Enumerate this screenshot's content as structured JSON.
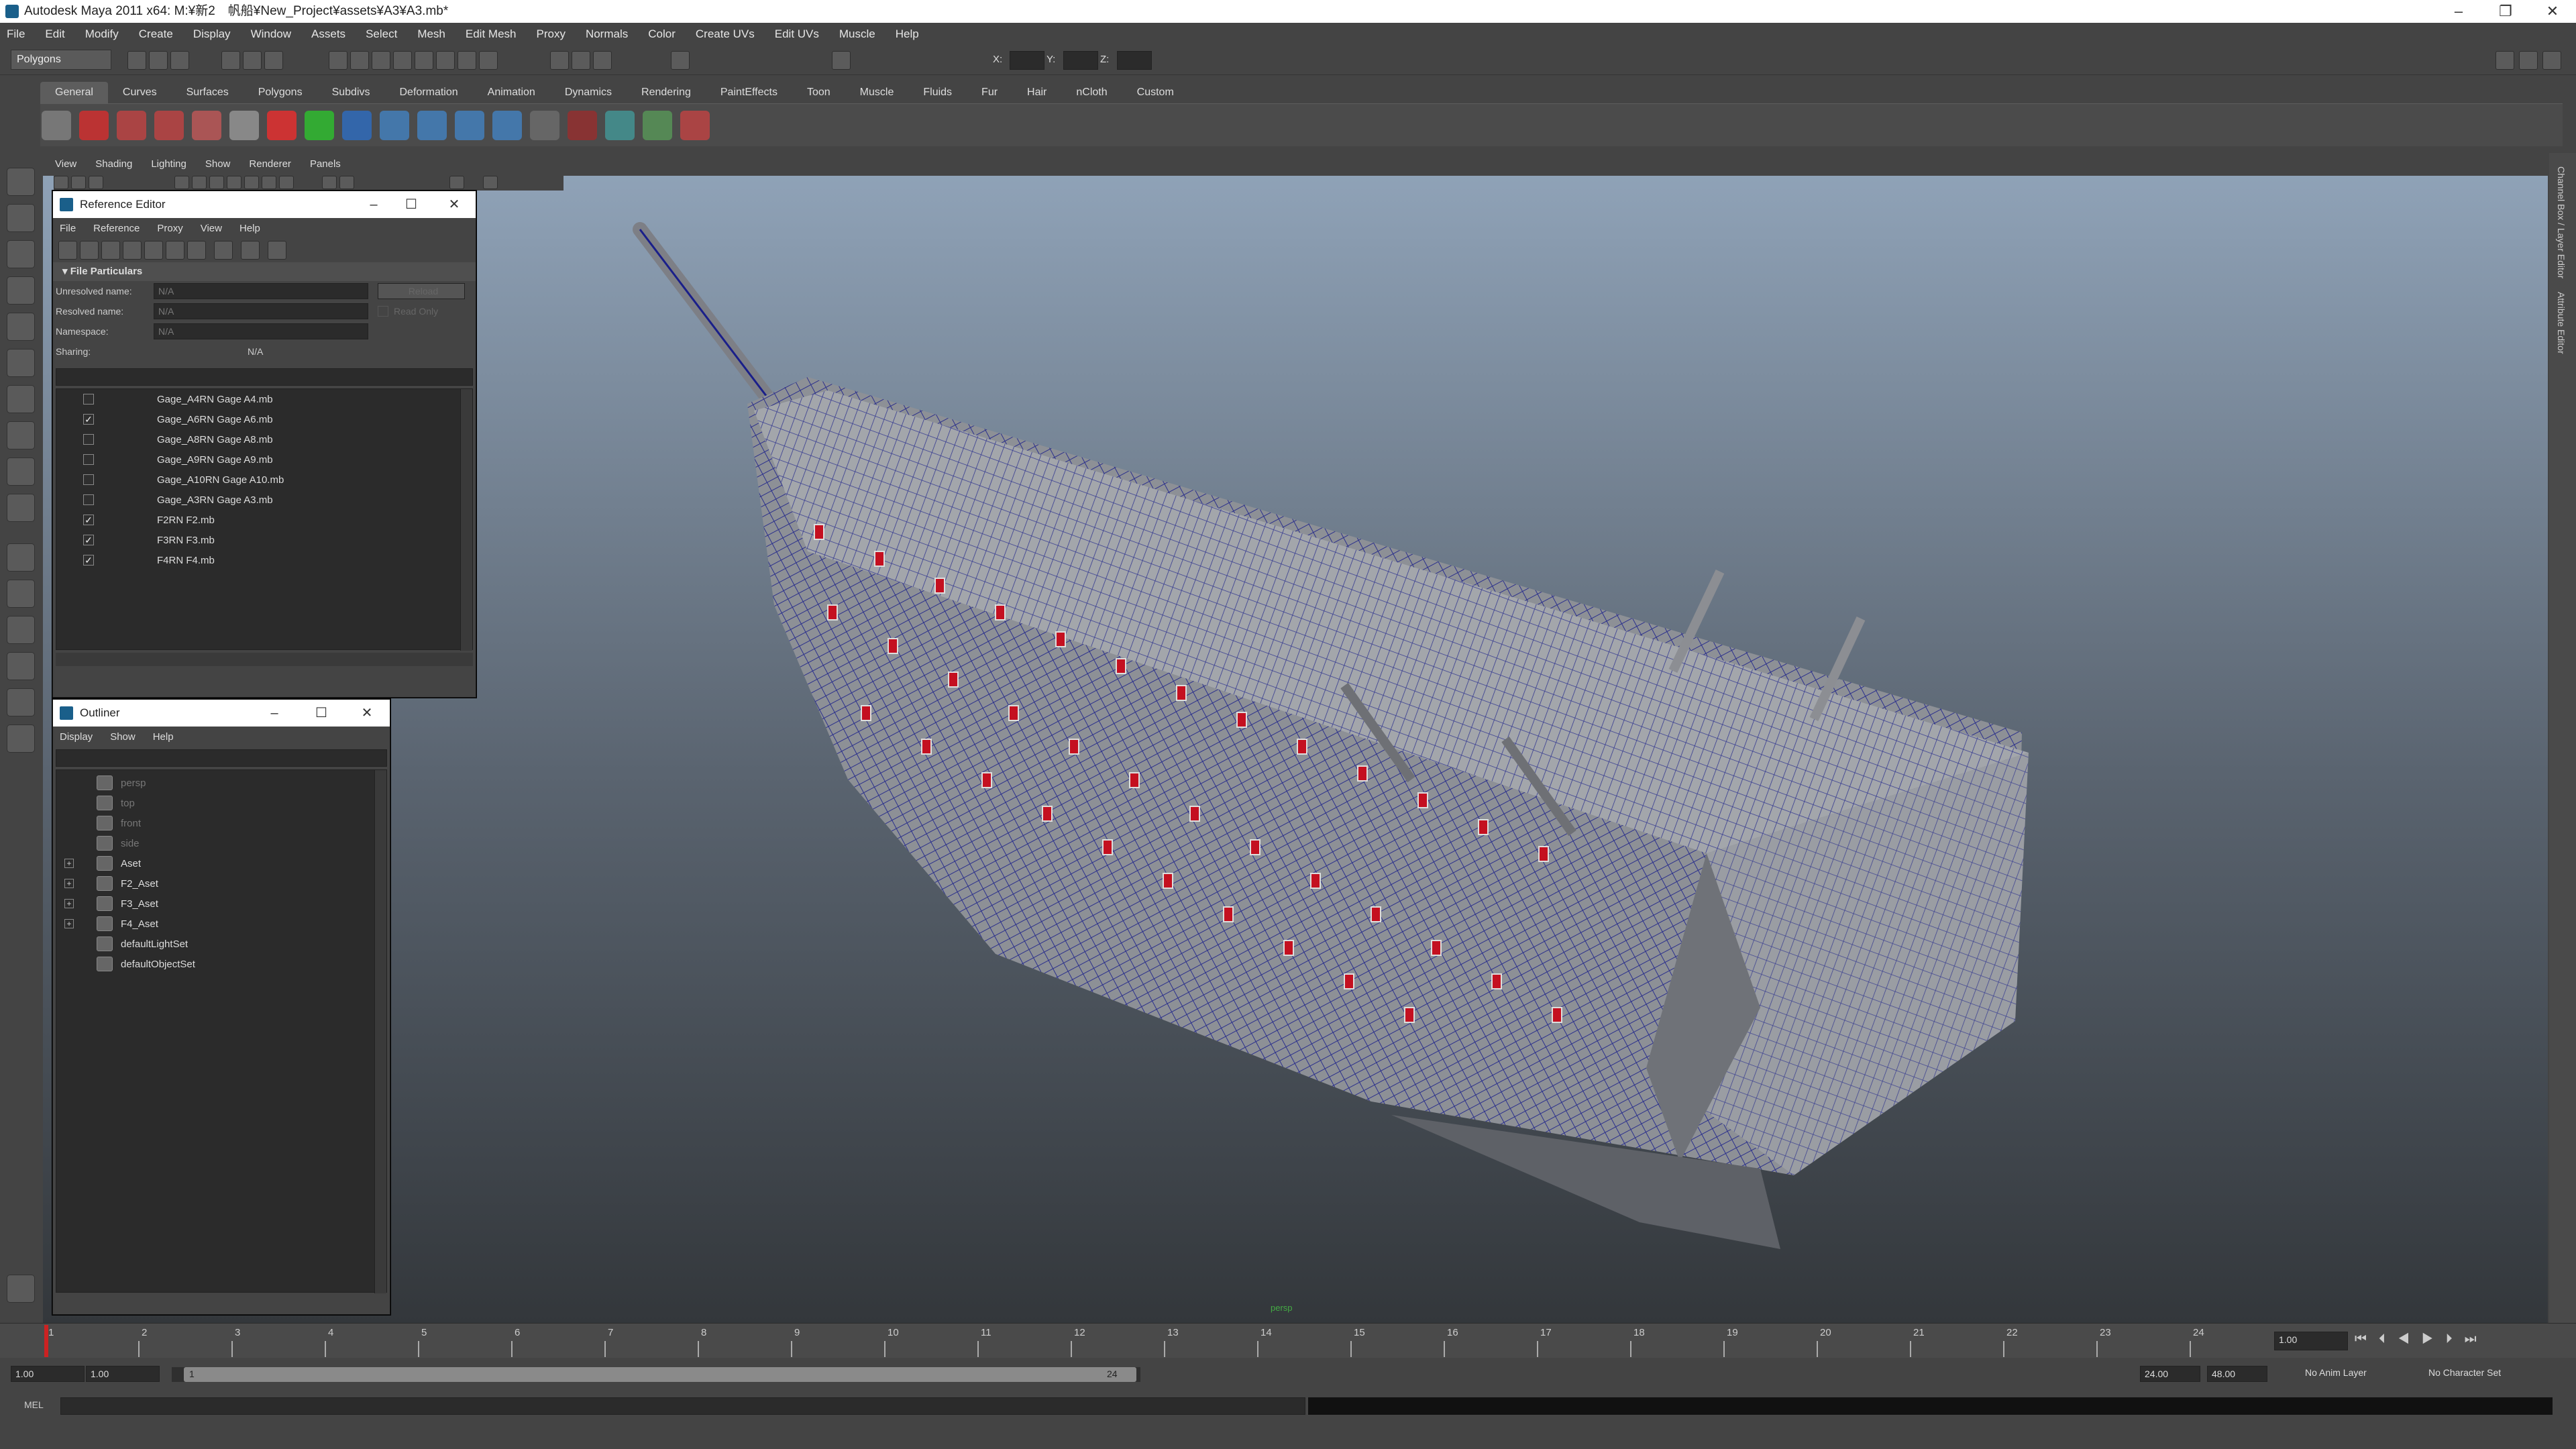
{
  "window": {
    "title": "Autodesk Maya 2011 x64: M:¥新2　帆船¥New_Project¥assets¥A3¥A3.mb*",
    "minimize": "–",
    "restore": "❐",
    "close": "✕"
  },
  "menubar": [
    "File",
    "Edit",
    "Modify",
    "Create",
    "Display",
    "Window",
    "Assets",
    "Select",
    "Mesh",
    "Edit Mesh",
    "Proxy",
    "Normals",
    "Color",
    "Create UVs",
    "Edit UVs",
    "Muscle",
    "Help"
  ],
  "statusline": {
    "mode": "Polygons",
    "x_label": "X:",
    "y_label": "Y:",
    "z_label": "Z:"
  },
  "shelf_tabs": {
    "active": "General",
    "items": [
      "General",
      "Curves",
      "Surfaces",
      "Polygons",
      "Subdivs",
      "Deformation",
      "Animation",
      "Dynamics",
      "Rendering",
      "PaintEffects",
      "Toon",
      "Muscle",
      "Fluids",
      "Fur",
      "Hair",
      "nCloth",
      "Custom"
    ]
  },
  "panel_menu": [
    "View",
    "Shading",
    "Lighting",
    "Show",
    "Renderer",
    "Panels"
  ],
  "reference_editor": {
    "title": "Reference Editor",
    "menu": [
      "File",
      "Reference",
      "Proxy",
      "View",
      "Help"
    ],
    "section": "File Particulars",
    "unresolved_label": "Unresolved name:",
    "unresolved_value": "N/A",
    "resolved_label": "Resolved name:",
    "resolved_value": "N/A",
    "namespace_label": "Namespace:",
    "namespace_value": "N/A",
    "sharing_label": "Sharing:",
    "sharing_value": "N/A",
    "reload": "Reload",
    "read_only": "Read Only",
    "items": [
      {
        "name": "Gage_A4RN Gage A4.mb",
        "checked": false
      },
      {
        "name": "Gage_A6RN Gage A6.mb",
        "checked": true
      },
      {
        "name": "Gage_A8RN Gage A8.mb",
        "checked": false
      },
      {
        "name": "Gage_A9RN Gage A9.mb",
        "checked": false
      },
      {
        "name": "Gage_A10RN Gage A10.mb",
        "checked": false
      },
      {
        "name": "Gage_A3RN Gage A3.mb",
        "checked": false
      },
      {
        "name": "F2RN F2.mb",
        "checked": true
      },
      {
        "name": "F3RN F3.mb",
        "checked": true
      },
      {
        "name": "F4RN F4.mb",
        "checked": true
      }
    ]
  },
  "outliner": {
    "title": "Outliner",
    "menu": [
      "Display",
      "Show",
      "Help"
    ],
    "items": [
      {
        "name": "persp",
        "dim": true,
        "expand": false
      },
      {
        "name": "top",
        "dim": true,
        "expand": false
      },
      {
        "name": "front",
        "dim": true,
        "expand": false
      },
      {
        "name": "side",
        "dim": true,
        "expand": false
      },
      {
        "name": "Aset",
        "dim": false,
        "expand": true
      },
      {
        "name": "F2_Aset",
        "dim": false,
        "expand": true
      },
      {
        "name": "F3_Aset",
        "dim": false,
        "expand": true
      },
      {
        "name": "F4_Aset",
        "dim": false,
        "expand": true
      },
      {
        "name": "defaultLightSet",
        "dim": false,
        "expand": false
      },
      {
        "name": "defaultObjectSet",
        "dim": false,
        "expand": false
      }
    ]
  },
  "viewport": {
    "camera_label": "persp"
  },
  "timeline": {
    "ticks": [
      "1",
      "2",
      "3",
      "4",
      "5",
      "6",
      "7",
      "8",
      "9",
      "10",
      "11",
      "12",
      "13",
      "14",
      "15",
      "16",
      "17",
      "18",
      "19",
      "20",
      "21",
      "22",
      "23",
      "24"
    ],
    "current_frame": "1.00"
  },
  "range": {
    "start": "1.00",
    "playback_start": "1.00",
    "slider_start": "1",
    "slider_end": "24",
    "playback_end": "24.00",
    "end": "48.00",
    "anim_layer": "No Anim Layer",
    "char_set": "No Character Set"
  },
  "cmdline": {
    "label": "MEL"
  },
  "dock": {
    "channel_box": "Channel Box / Layer Editor",
    "attr_editor": "Attribute Editor"
  },
  "colors": {
    "hull_wire": "#1a1f8a",
    "gunport": "#c41020",
    "viewport_top": "#8fa2b7",
    "viewport_bottom": "#33373b"
  }
}
